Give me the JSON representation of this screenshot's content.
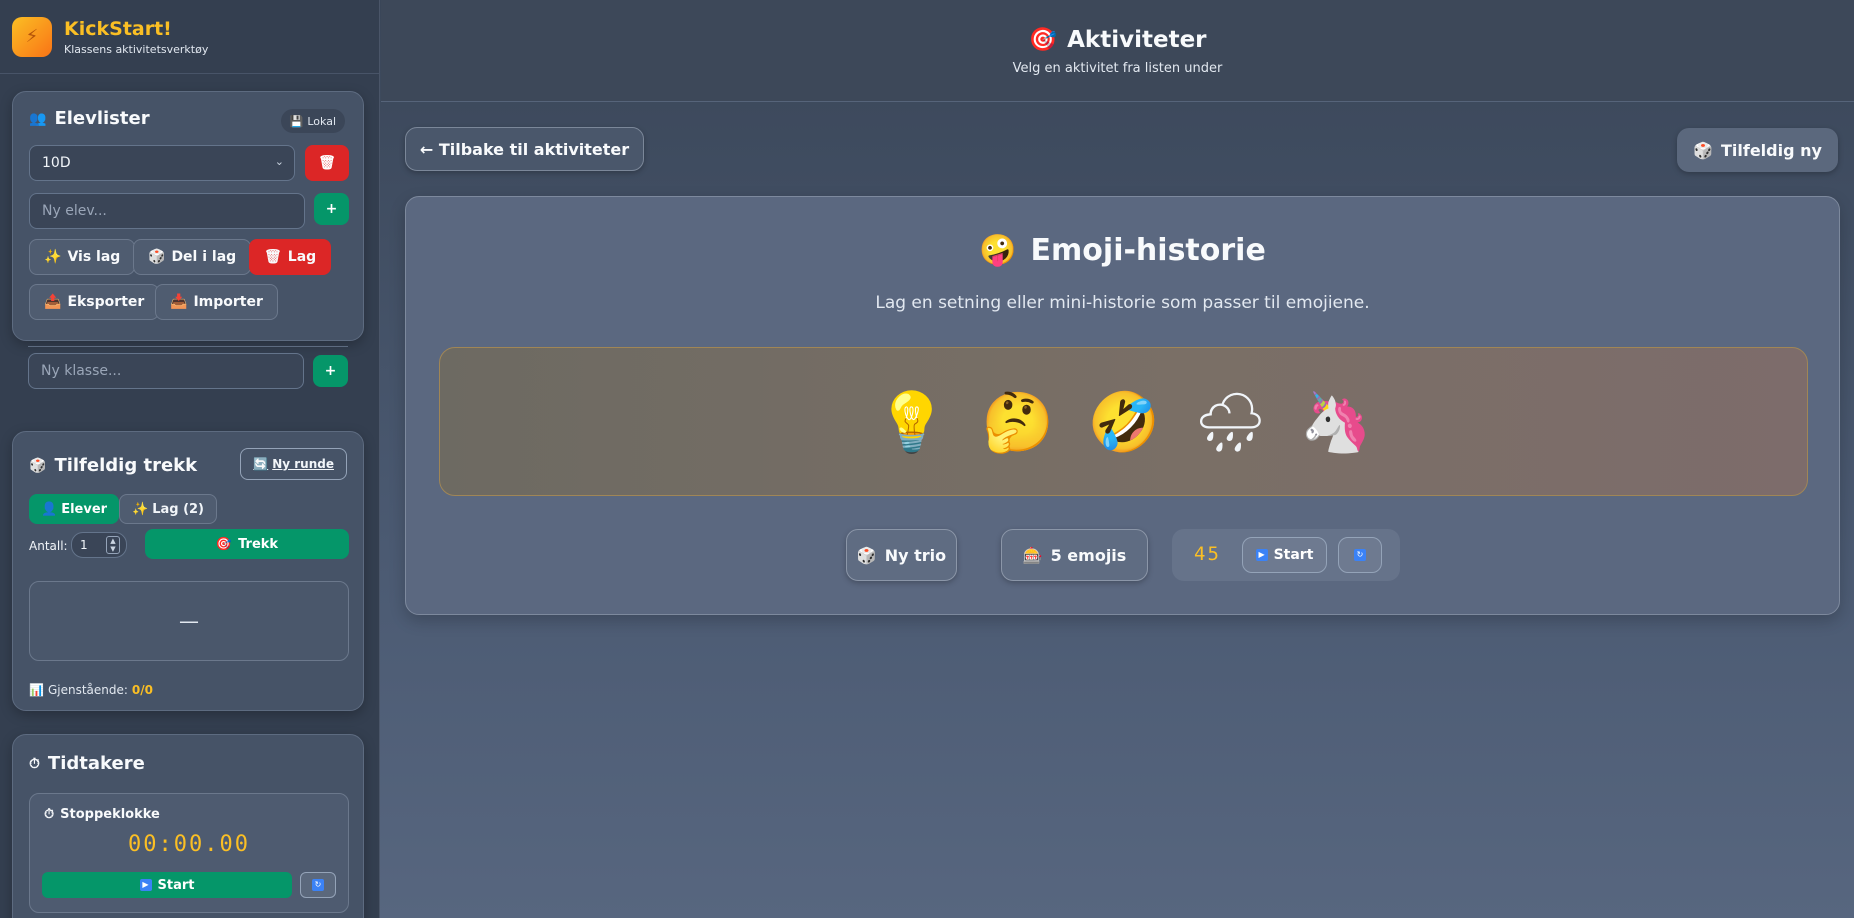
{
  "brand": {
    "title": "KickStart!",
    "subtitle": "Klassens aktivitetsverktøy",
    "logo_icon": "⚡"
  },
  "students": {
    "title": "Elevlister",
    "title_icon": "👥",
    "storage_badge": "Lokal",
    "storage_icon": "💾",
    "class_select": "10D",
    "delete_icon": "🗑",
    "new_student_placeholder": "Ny elev...",
    "add_label": "+",
    "buttons": [
      {
        "icon": "✨",
        "label": "Vis lag"
      },
      {
        "icon": "🎲",
        "label": "Del i lag"
      },
      {
        "icon": "🗑",
        "label": "Lag"
      }
    ],
    "io_buttons": [
      {
        "icon": "📤",
        "label": "Eksporter"
      },
      {
        "icon": "📥",
        "label": "Importer"
      }
    ],
    "new_class_placeholder": "Ny klasse..."
  },
  "random_draw": {
    "title": "Tilfeldig trekk",
    "title_icon": "🎲",
    "new_round": "Ny runde",
    "new_round_icon": "🔄",
    "tab_students": "Elever",
    "tab_students_icon": "👤",
    "tab_teams": "Lag (2)",
    "tab_teams_icon": "✨",
    "count_label": "Antall:",
    "count_value": "1",
    "draw_label": "Trekk",
    "draw_icon": "🎯",
    "result": "—",
    "remaining_icon": "📊",
    "remaining_label": "Gjenstående:",
    "remaining_value": "0/0"
  },
  "timers": {
    "title": "Tidtakere",
    "title_icon": "⏱",
    "stopwatch_title": "Stoppeklokke",
    "stopwatch_icon": "⏱",
    "stopwatch_time": "00:00.00",
    "start_label": "Start",
    "reset_icon": "🔄"
  },
  "header": {
    "title": "Aktiviteter",
    "icon": "🎯",
    "subtitle": "Velg en aktivitet fra listen under"
  },
  "nav": {
    "back_label": "← Tilbake til aktiviteter",
    "random_label": "Tilfeldig ny",
    "random_icon": "🎲"
  },
  "activity": {
    "title": "Emoji-historie",
    "title_icon": "🤪",
    "description": "Lag en setning eller mini-historie som passer til emojiene.",
    "emojis": [
      "💡",
      "🤔",
      "🤣",
      "🌧",
      "🦄"
    ],
    "btn_trio": "Ny trio",
    "btn_trio_icon": "🎲",
    "btn_five": "5 emojis",
    "btn_five_icon": "🎰",
    "timer_value": "45",
    "timer_start": "Start",
    "timer_reset_icon": "🔄"
  },
  "colors": {
    "accent": "#fbbf24",
    "green": "#059669",
    "red": "#dc2626"
  }
}
